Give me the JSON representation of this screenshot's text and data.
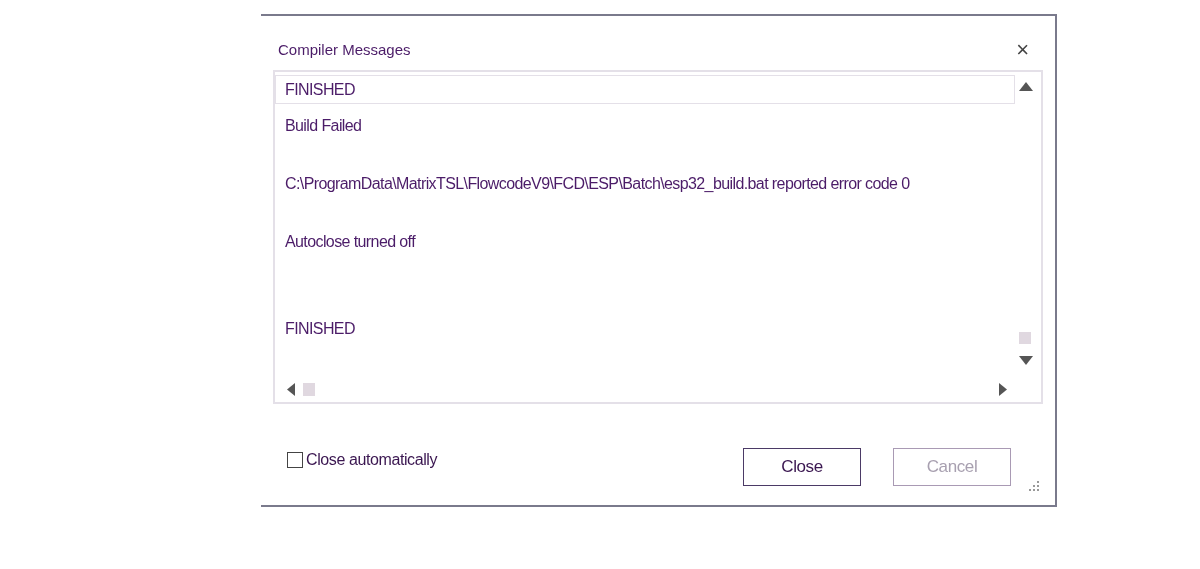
{
  "dialog": {
    "title": "Compiler Messages",
    "close_glyph": "×"
  },
  "messages": [
    {
      "text": "FINISHED",
      "selected": true
    },
    {
      "text": "Build Failed",
      "selected": false
    },
    {
      "text": "C:\\ProgramData\\MatrixTSL\\FlowcodeV9\\FCD\\ESP\\Batch\\esp32_build.bat reported error code 0",
      "selected": false
    },
    {
      "text": "Autoclose turned off",
      "selected": false
    },
    {
      "text": "FINISHED",
      "selected": false
    }
  ],
  "close_automatically": {
    "label": "Close automatically",
    "checked": false
  },
  "buttons": [
    {
      "label": "Close",
      "disabled": false
    },
    {
      "label": "Cancel",
      "disabled": true
    }
  ]
}
